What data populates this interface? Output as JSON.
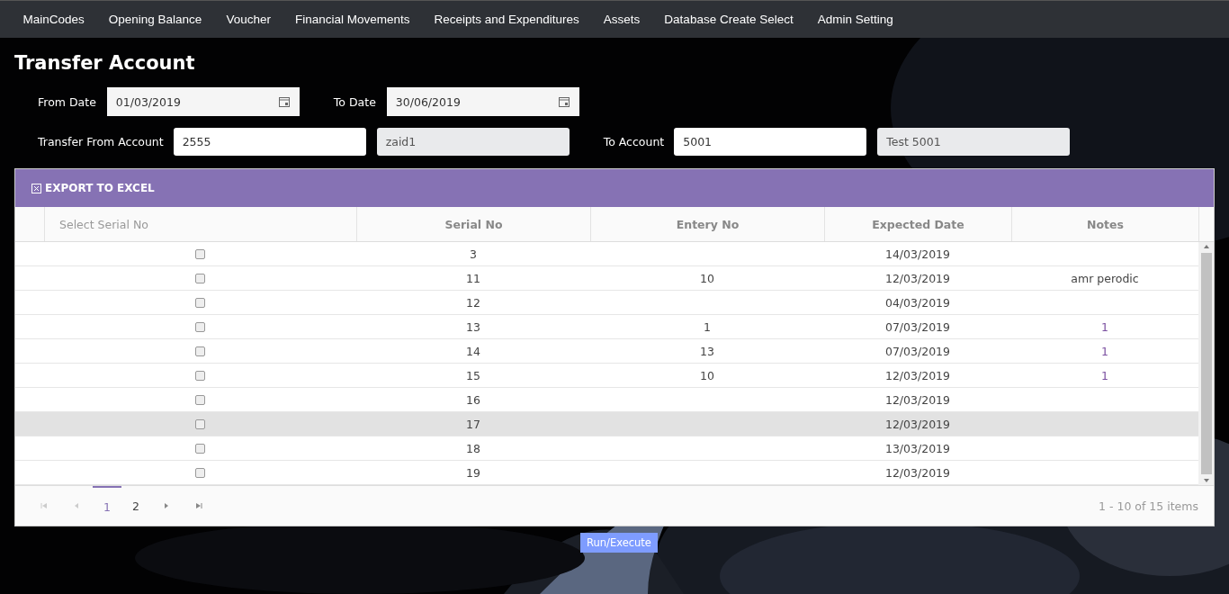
{
  "nav": {
    "items": [
      "MainCodes",
      "Opening Balance",
      "Voucher",
      "Financial Movements",
      "Receipts and Expenditures",
      "Assets",
      "Database Create Select",
      "Admin Setting"
    ]
  },
  "page_title": "Transfer Account",
  "filters": {
    "from_date": {
      "label": "From Date",
      "value": "01/03/2019"
    },
    "to_date": {
      "label": "To Date",
      "value": "30/06/2019"
    },
    "from_account": {
      "label": "Transfer From Account",
      "value": "2555",
      "name": "zaid1"
    },
    "to_account": {
      "label": "To Account",
      "value": "5001",
      "name": "Test 5001"
    }
  },
  "grid": {
    "toolbar": {
      "label": "EXPORT TO EXCEL"
    },
    "columns": [
      "Select Serial No",
      "Serial No",
      "Entery No",
      "Expected Date",
      "Notes"
    ],
    "rows": [
      {
        "checked": false,
        "selected": false,
        "serial_no": "3",
        "entry_no": "",
        "expected_date": "14/03/2019",
        "notes": ""
      },
      {
        "checked": false,
        "selected": false,
        "serial_no": "11",
        "entry_no": "10",
        "expected_date": "12/03/2019",
        "notes": "amr perodic"
      },
      {
        "checked": false,
        "selected": false,
        "serial_no": "12",
        "entry_no": "",
        "expected_date": "04/03/2019",
        "notes": ""
      },
      {
        "checked": false,
        "selected": false,
        "serial_no": "13",
        "entry_no": "1",
        "expected_date": "07/03/2019",
        "notes": "1"
      },
      {
        "checked": false,
        "selected": false,
        "serial_no": "14",
        "entry_no": "13",
        "expected_date": "07/03/2019",
        "notes": "1"
      },
      {
        "checked": false,
        "selected": false,
        "serial_no": "15",
        "entry_no": "10",
        "expected_date": "12/03/2019",
        "notes": "1"
      },
      {
        "checked": false,
        "selected": false,
        "serial_no": "16",
        "entry_no": "",
        "expected_date": "12/03/2019",
        "notes": ""
      },
      {
        "checked": false,
        "selected": true,
        "serial_no": "17",
        "entry_no": "",
        "expected_date": "12/03/2019",
        "notes": ""
      },
      {
        "checked": false,
        "selected": false,
        "serial_no": "18",
        "entry_no": "",
        "expected_date": "13/03/2019",
        "notes": ""
      },
      {
        "checked": false,
        "selected": false,
        "serial_no": "19",
        "entry_no": "",
        "expected_date": "12/03/2019",
        "notes": ""
      }
    ],
    "pager": {
      "pages": [
        {
          "label": "1",
          "selected": true
        },
        {
          "label": "2",
          "selected": false
        }
      ],
      "info": "1 - 10 of 15 items"
    }
  },
  "run_button": {
    "label": "Run/Execute"
  }
}
